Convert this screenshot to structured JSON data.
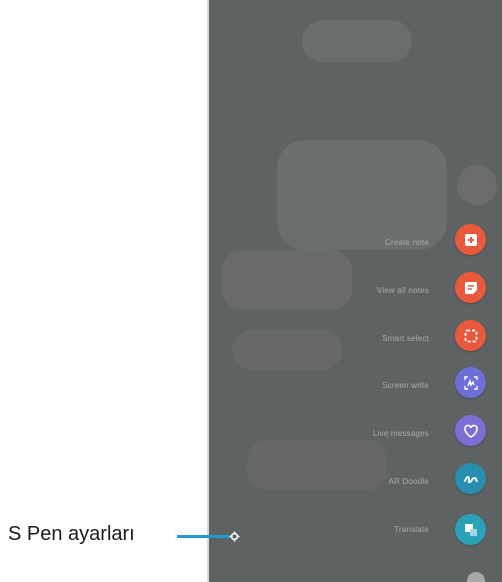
{
  "callout": {
    "label": "S Pen ayarları"
  },
  "menu": {
    "items": [
      {
        "key": "create-note",
        "label": "Create note",
        "color": "#e8593e",
        "icon": "note-add-icon"
      },
      {
        "key": "view-all-notes",
        "label": "View all notes",
        "color": "#e8593e",
        "icon": "notes-list-icon"
      },
      {
        "key": "smart-select",
        "label": "Smart select",
        "color": "#e8593e",
        "icon": "smart-select-icon"
      },
      {
        "key": "screen-write",
        "label": "Screen write",
        "color": "#6d6fd6",
        "icon": "screen-write-icon"
      },
      {
        "key": "live-messages",
        "label": "Live messages",
        "color": "#7b6fd6",
        "icon": "heart-icon"
      },
      {
        "key": "ar-doodle",
        "label": "AR Doodle",
        "color": "#2a8eb0",
        "icon": "doodle-icon"
      },
      {
        "key": "translate",
        "label": "Translate",
        "color": "#2aa3b8",
        "icon": "translate-icon"
      }
    ]
  },
  "colors": {
    "leader": "#1f9ad6",
    "panel": "#5f6263"
  }
}
